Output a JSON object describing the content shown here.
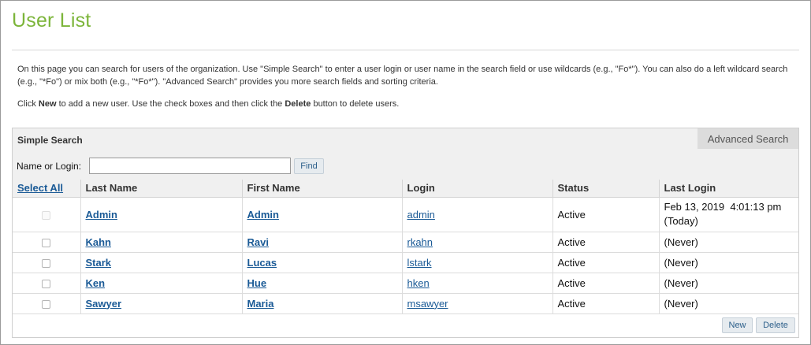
{
  "page": {
    "title": "User List",
    "intro_1": "On this page you can search for users of the organization. Use \"Simple Search\" to enter a user login or user name in the search field or use wildcards (e.g., \"Fo*\"). You can also do a left wildcard search (e.g., \"*Fo\") or mix both (e.g., \"*Fo*\"). \"Advanced Search\" provides you more search fields and sorting criteria.",
    "intro_2_prefix": "Click ",
    "intro_2_new": "New",
    "intro_2_middle": " to add a new user. Use the check boxes and then click the ",
    "intro_2_delete": "Delete",
    "intro_2_suffix": " button to delete users."
  },
  "search": {
    "panel_title": "Simple Search",
    "advanced_tab": "Advanced Search",
    "label": "Name or Login:",
    "value": "",
    "placeholder": "",
    "find_label": "Find"
  },
  "table": {
    "headers": {
      "select_all": "Select All",
      "last_name": "Last Name",
      "first_name": "First Name",
      "login": "Login",
      "status": "Status",
      "last_login": "Last Login"
    },
    "rows": [
      {
        "last_name": "Admin",
        "first_name": "Admin",
        "login": "admin",
        "status": "Active",
        "last_login": "Feb 13, 2019  4:01:13 pm",
        "last_login_note": "(Today)",
        "checkbox_disabled": true
      },
      {
        "last_name": "Kahn",
        "first_name": "Ravi",
        "login": "rkahn",
        "status": "Active",
        "last_login": "(Never)",
        "last_login_note": "",
        "checkbox_disabled": false
      },
      {
        "last_name": "Stark",
        "first_name": "Lucas",
        "login": "lstark",
        "status": "Active",
        "last_login": "(Never)",
        "last_login_note": "",
        "checkbox_disabled": false
      },
      {
        "last_name": "Ken",
        "first_name": "Hue",
        "login": "hken",
        "status": "Active",
        "last_login": "(Never)",
        "last_login_note": "",
        "checkbox_disabled": false
      },
      {
        "last_name": "Sawyer",
        "first_name": "Maria",
        "login": "msawyer",
        "status": "Active",
        "last_login": "(Never)",
        "last_login_note": "",
        "checkbox_disabled": false
      }
    ]
  },
  "actions": {
    "new_label": "New",
    "delete_label": "Delete"
  },
  "colors": {
    "title": "#7cb53a",
    "link": "#1a5a96",
    "header_bg": "#f0f0f0",
    "advanced_tab_bg": "#dcdcdc"
  }
}
